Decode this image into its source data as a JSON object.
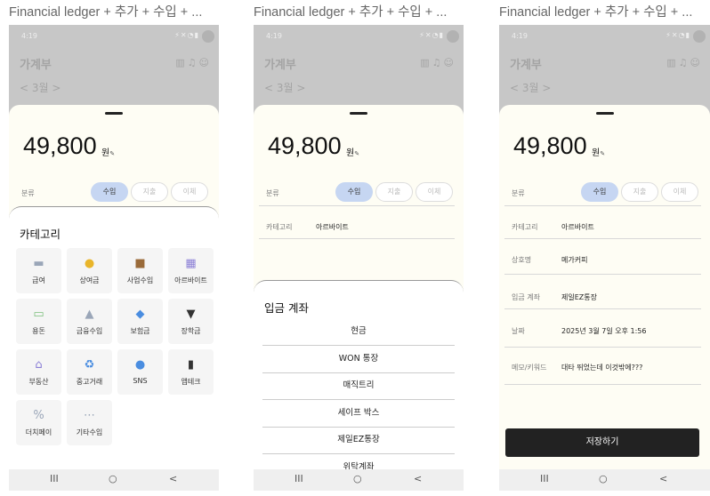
{
  "panel_title": "Financial ledger + 추가 + 수입 + ...",
  "status": {
    "time": "4:19",
    "icons": "⚡✕◔▮"
  },
  "app": {
    "title": "가계부",
    "month": "< 3월 >"
  },
  "entry": {
    "amount": "49,800",
    "unit": "원",
    "edit_icon": "✎",
    "category_label": "분류",
    "tabs": [
      "수입",
      "지출",
      "이체"
    ]
  },
  "category_sheet": {
    "title": "카테고리",
    "items": [
      {
        "label": "급여",
        "icon": "salary-icon",
        "color": "#9aa6b8"
      },
      {
        "label": "상여금",
        "icon": "bonus-icon",
        "color": "#e9b52a"
      },
      {
        "label": "사업수입",
        "icon": "briefcase-icon",
        "color": "#9a6b3a"
      },
      {
        "label": "아르바이트",
        "icon": "part-time-icon",
        "color": "#8b7fd6"
      },
      {
        "label": "용돈",
        "icon": "allowance-icon",
        "color": "#7cbf7c"
      },
      {
        "label": "금융수입",
        "icon": "bank-icon",
        "color": "#9aa6b8"
      },
      {
        "label": "보험금",
        "icon": "insurance-icon",
        "color": "#4a8de0"
      },
      {
        "label": "장학금",
        "icon": "graduation-icon",
        "color": "#333333"
      },
      {
        "label": "부동산",
        "icon": "real-estate-icon",
        "color": "#8b7fd6"
      },
      {
        "label": "중고거래",
        "icon": "recycle-icon",
        "color": "#4a8de0"
      },
      {
        "label": "SNS",
        "icon": "chat-icon",
        "color": "#4a8de0"
      },
      {
        "label": "앱테크",
        "icon": "phone-icon",
        "color": "#333333"
      },
      {
        "label": "더치페이",
        "icon": "dutch-pay-icon",
        "color": "#9aa6b8"
      },
      {
        "label": "기타수입",
        "icon": "more-icon",
        "color": "#9aa6b8"
      }
    ]
  },
  "fields": {
    "category": {
      "label": "카테고리",
      "value": "아르바이트"
    },
    "merchant": {
      "label": "상호명",
      "value": "메가커피"
    },
    "account": {
      "label": "입금 계좌",
      "value": "제일EZ통장"
    },
    "date": {
      "label": "날짜",
      "value": "2025년 3월 7일 오후 1:56"
    },
    "memo": {
      "label": "메모/키워드",
      "value": "대타 뛰었는데 이것밖에???"
    }
  },
  "account_sheet": {
    "title": "입금 계좌",
    "options": [
      "현금",
      "WON 통장",
      "매직트리",
      "세이프 박스",
      "제일EZ통장",
      "위탁계좌"
    ]
  },
  "save_label": "저장하기",
  "nav": {
    "recents": "III",
    "home": "○",
    "back": "<"
  }
}
